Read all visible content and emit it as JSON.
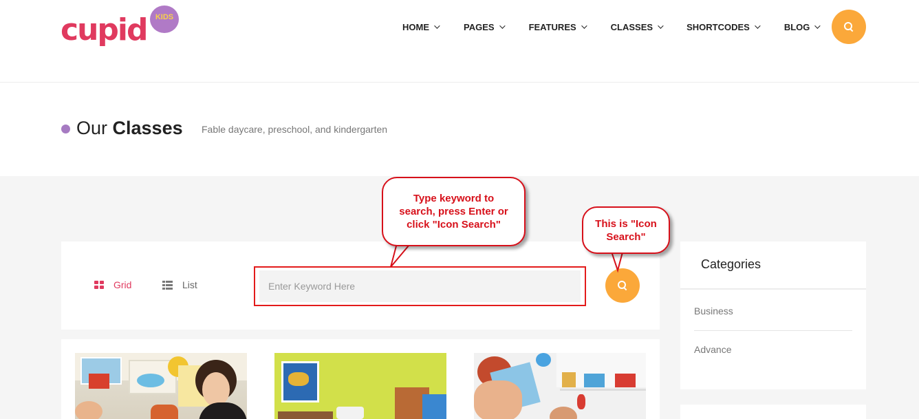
{
  "logo": {
    "text": "cupid",
    "badge": "KIDS"
  },
  "nav": {
    "items": [
      {
        "label": "HOME"
      },
      {
        "label": "PAGES"
      },
      {
        "label": "FEATURES"
      },
      {
        "label": "CLASSES"
      },
      {
        "label": "SHORTCODES"
      },
      {
        "label": "BLOG"
      }
    ],
    "search_icon": "search-icon"
  },
  "page": {
    "title_light": "Our ",
    "title_bold": "Classes",
    "subtitle": "Fable daycare, preschool, and kindergarten"
  },
  "toolbar": {
    "grid_label": "Grid",
    "list_label": "List",
    "search_placeholder": "Enter Keyword Here",
    "search_value": ""
  },
  "callouts": {
    "keyword_hint": "Type keyword to search, press Enter or click \"Icon Search\"",
    "icon_hint": "This is \"Icon Search\""
  },
  "sidebar": {
    "title": "Categories",
    "items": [
      {
        "label": "Business"
      },
      {
        "label": "Advance"
      }
    ]
  },
  "colors": {
    "accent_orange": "#fba83a",
    "brand_pink": "#e03a5f",
    "dot_purple": "#a67bc2",
    "annotation_red": "#d7101a"
  }
}
